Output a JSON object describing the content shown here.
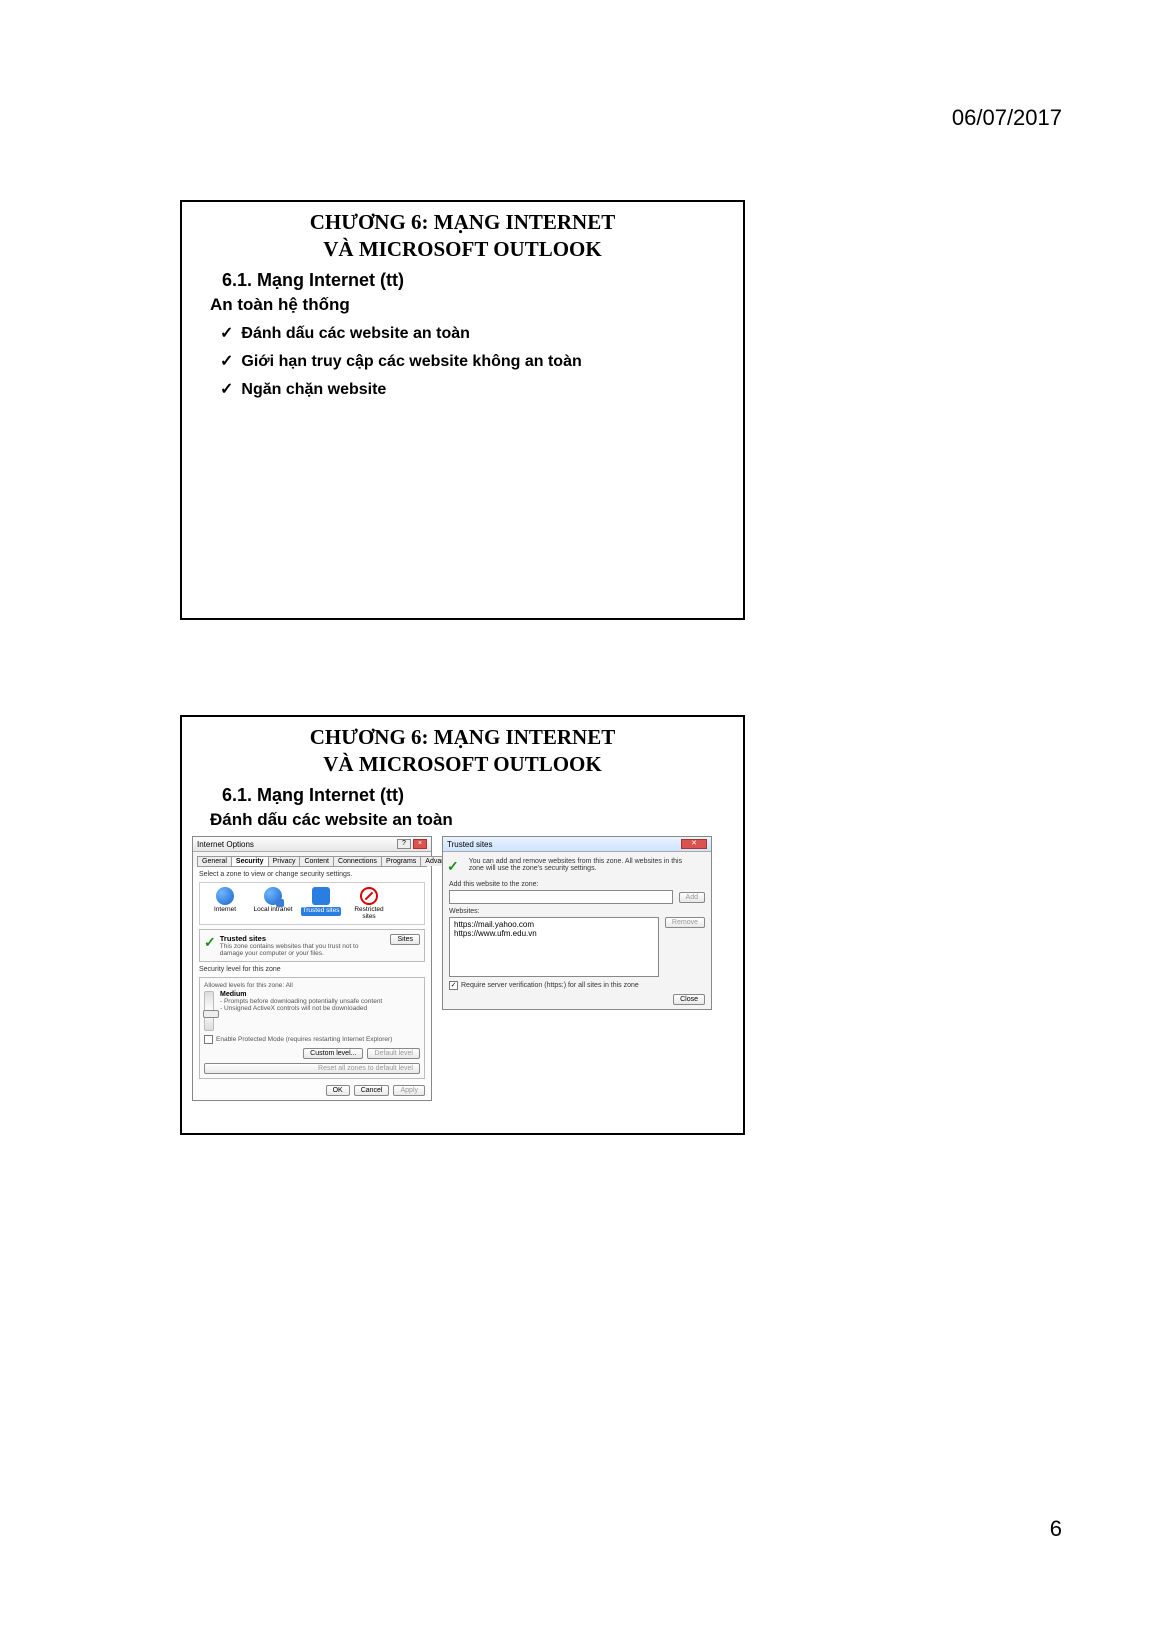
{
  "page": {
    "date": "06/07/2017",
    "number": "6"
  },
  "slide1": {
    "title_line1": "CHƯƠNG 6: MẠNG INTERNET",
    "title_line2": "VÀ MICROSOFT OUTLOOK",
    "section": "6.1. Mạng Internet (tt)",
    "subhead": "An toàn hệ thống",
    "bullets": {
      "b1": "Đánh dấu các website an toàn",
      "b2": "Giới hạn truy cập các website không an toàn",
      "b3": "Ngăn chặn website"
    }
  },
  "slide2": {
    "title_line1": "CHƯƠNG 6: MẠNG INTERNET",
    "title_line2": "VÀ MICROSOFT OUTLOOK",
    "section": "6.1. Mạng Internet (tt)",
    "subhead": "Đánh dấu các website an toàn",
    "internet_options": {
      "title": "Internet Options",
      "tabs": {
        "general": "General",
        "security": "Security",
        "privacy": "Privacy",
        "content": "Content",
        "connections": "Connections",
        "programs": "Programs",
        "advanced": "Advanced"
      },
      "select_zone_text": "Select a zone to view or change security settings.",
      "zones": {
        "internet": "Internet",
        "local": "Local intranet",
        "trusted": "Trusted sites",
        "restricted": "Restricted sites"
      },
      "trusted_box": {
        "heading": "Trusted sites",
        "desc": "This zone contains websites that you trust not to damage your computer or your files.",
        "sites_btn": "Sites"
      },
      "level_heading": "Security level for this zone",
      "allowed_levels": "Allowed levels for this zone: All",
      "level_name": "Medium",
      "level_l1": "- Prompts before downloading potentially unsafe content",
      "level_l2": "- Unsigned ActiveX controls will not be downloaded",
      "protected_mode": "Enable Protected Mode (requires restarting Internet Explorer)",
      "custom_btn": "Custom level...",
      "default_btn": "Default level",
      "reset_btn": "Reset all zones to default level",
      "ok": "OK",
      "cancel": "Cancel",
      "apply": "Apply"
    },
    "trusted_sites": {
      "title": "Trusted sites",
      "info": "You can add and remove websites from this zone. All websites in this zone will use the zone's security settings.",
      "add_label": "Add this website to the zone:",
      "add_btn": "Add",
      "websites_label": "Websites:",
      "list": {
        "i0": "https://mail.yahoo.com",
        "i1": "https://www.ufm.edu.vn"
      },
      "remove_btn": "Remove",
      "require_https": "Require server verification (https:) for all sites in this zone",
      "close_btn": "Close"
    }
  }
}
